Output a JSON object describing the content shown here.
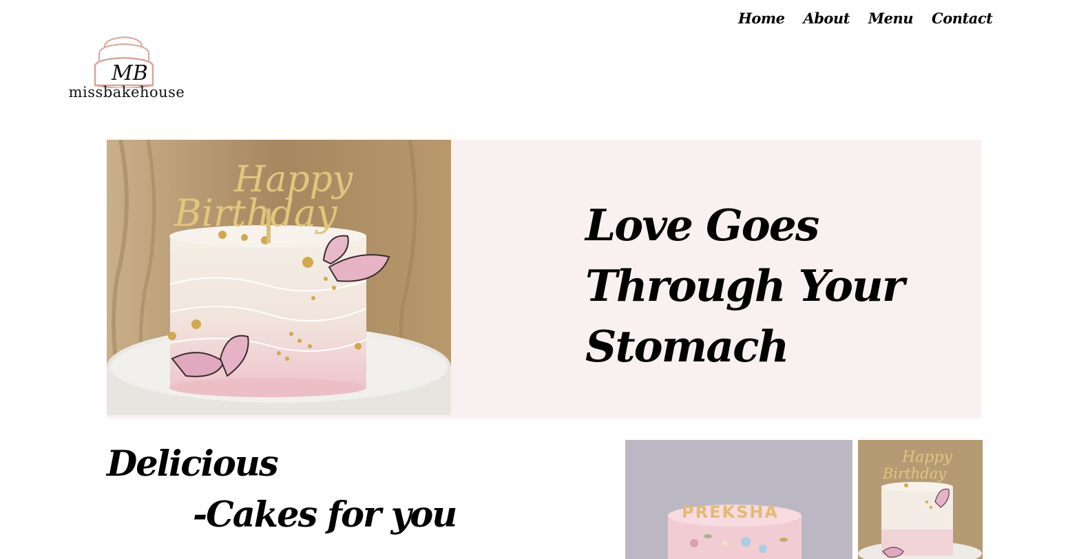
{
  "nav": {
    "items": [
      {
        "label": "Home"
      },
      {
        "label": "About"
      },
      {
        "label": "Menu"
      },
      {
        "label": "Contact"
      }
    ]
  },
  "logo": {
    "monogram": "MB",
    "text": "missbakehouse",
    "colors": {
      "cake_outline": "#d9a39a",
      "ink": "#111111"
    }
  },
  "hero": {
    "title_line1": "Love Goes",
    "title_line2": "Through Your",
    "title_line3": "Stomach",
    "background": "#f9f1f1",
    "image": {
      "topper_line1": "Happy",
      "topper_line2": "Birthday",
      "description_icon": "birthday-cake-butterflies-image"
    }
  },
  "tagline": {
    "line1": "Delicious",
    "line2": "-Cakes for you"
  },
  "gallery": {
    "thumb1": {
      "cake_name": "PREKSHA",
      "icon": "floral-cake-image"
    },
    "thumb2": {
      "topper_line1": "Happy",
      "topper_line2": "Birthday",
      "icon": "birthday-cake-thumbnail-image"
    }
  }
}
